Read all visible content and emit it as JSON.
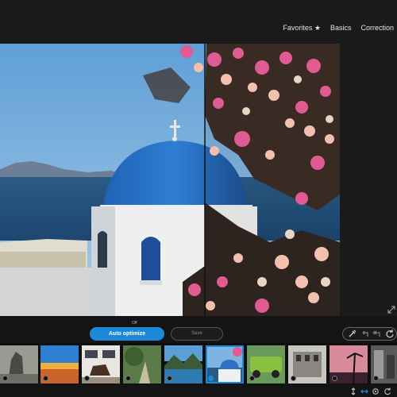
{
  "tabs": [
    {
      "label": "Favorites ★"
    },
    {
      "label": "Basics"
    },
    {
      "label": "Correction"
    }
  ],
  "toolbar": {
    "preset_hint": "Off",
    "auto_optimize_label": "Auto optimize",
    "save_label": "Save"
  },
  "colors": {
    "accent": "#1e88d8",
    "background": "#141414",
    "panel": "#1a1a1a"
  },
  "filmstrip": {
    "thumbnails": [
      {
        "subject": "tree-and-bench",
        "selected": false
      },
      {
        "subject": "desert-sunset",
        "selected": false
      },
      {
        "subject": "horse-in-village",
        "selected": false
      },
      {
        "subject": "garden-path",
        "selected": false
      },
      {
        "subject": "mountain-lake",
        "selected": false
      },
      {
        "subject": "blue-dome-chapel",
        "selected": true
      },
      {
        "subject": "vintage-green-truck",
        "selected": false
      },
      {
        "subject": "town-square",
        "selected": false
      },
      {
        "subject": "palm-sunset",
        "selected": false
      },
      {
        "subject": "monochrome-street",
        "selected": false
      }
    ]
  },
  "icons": [
    "eyedropper-icon",
    "undo-icon",
    "undo-all-icon",
    "reset-icon",
    "resize-vertical-icon",
    "compare-icon",
    "settings-icon",
    "rotate-icon",
    "expand-icon"
  ]
}
